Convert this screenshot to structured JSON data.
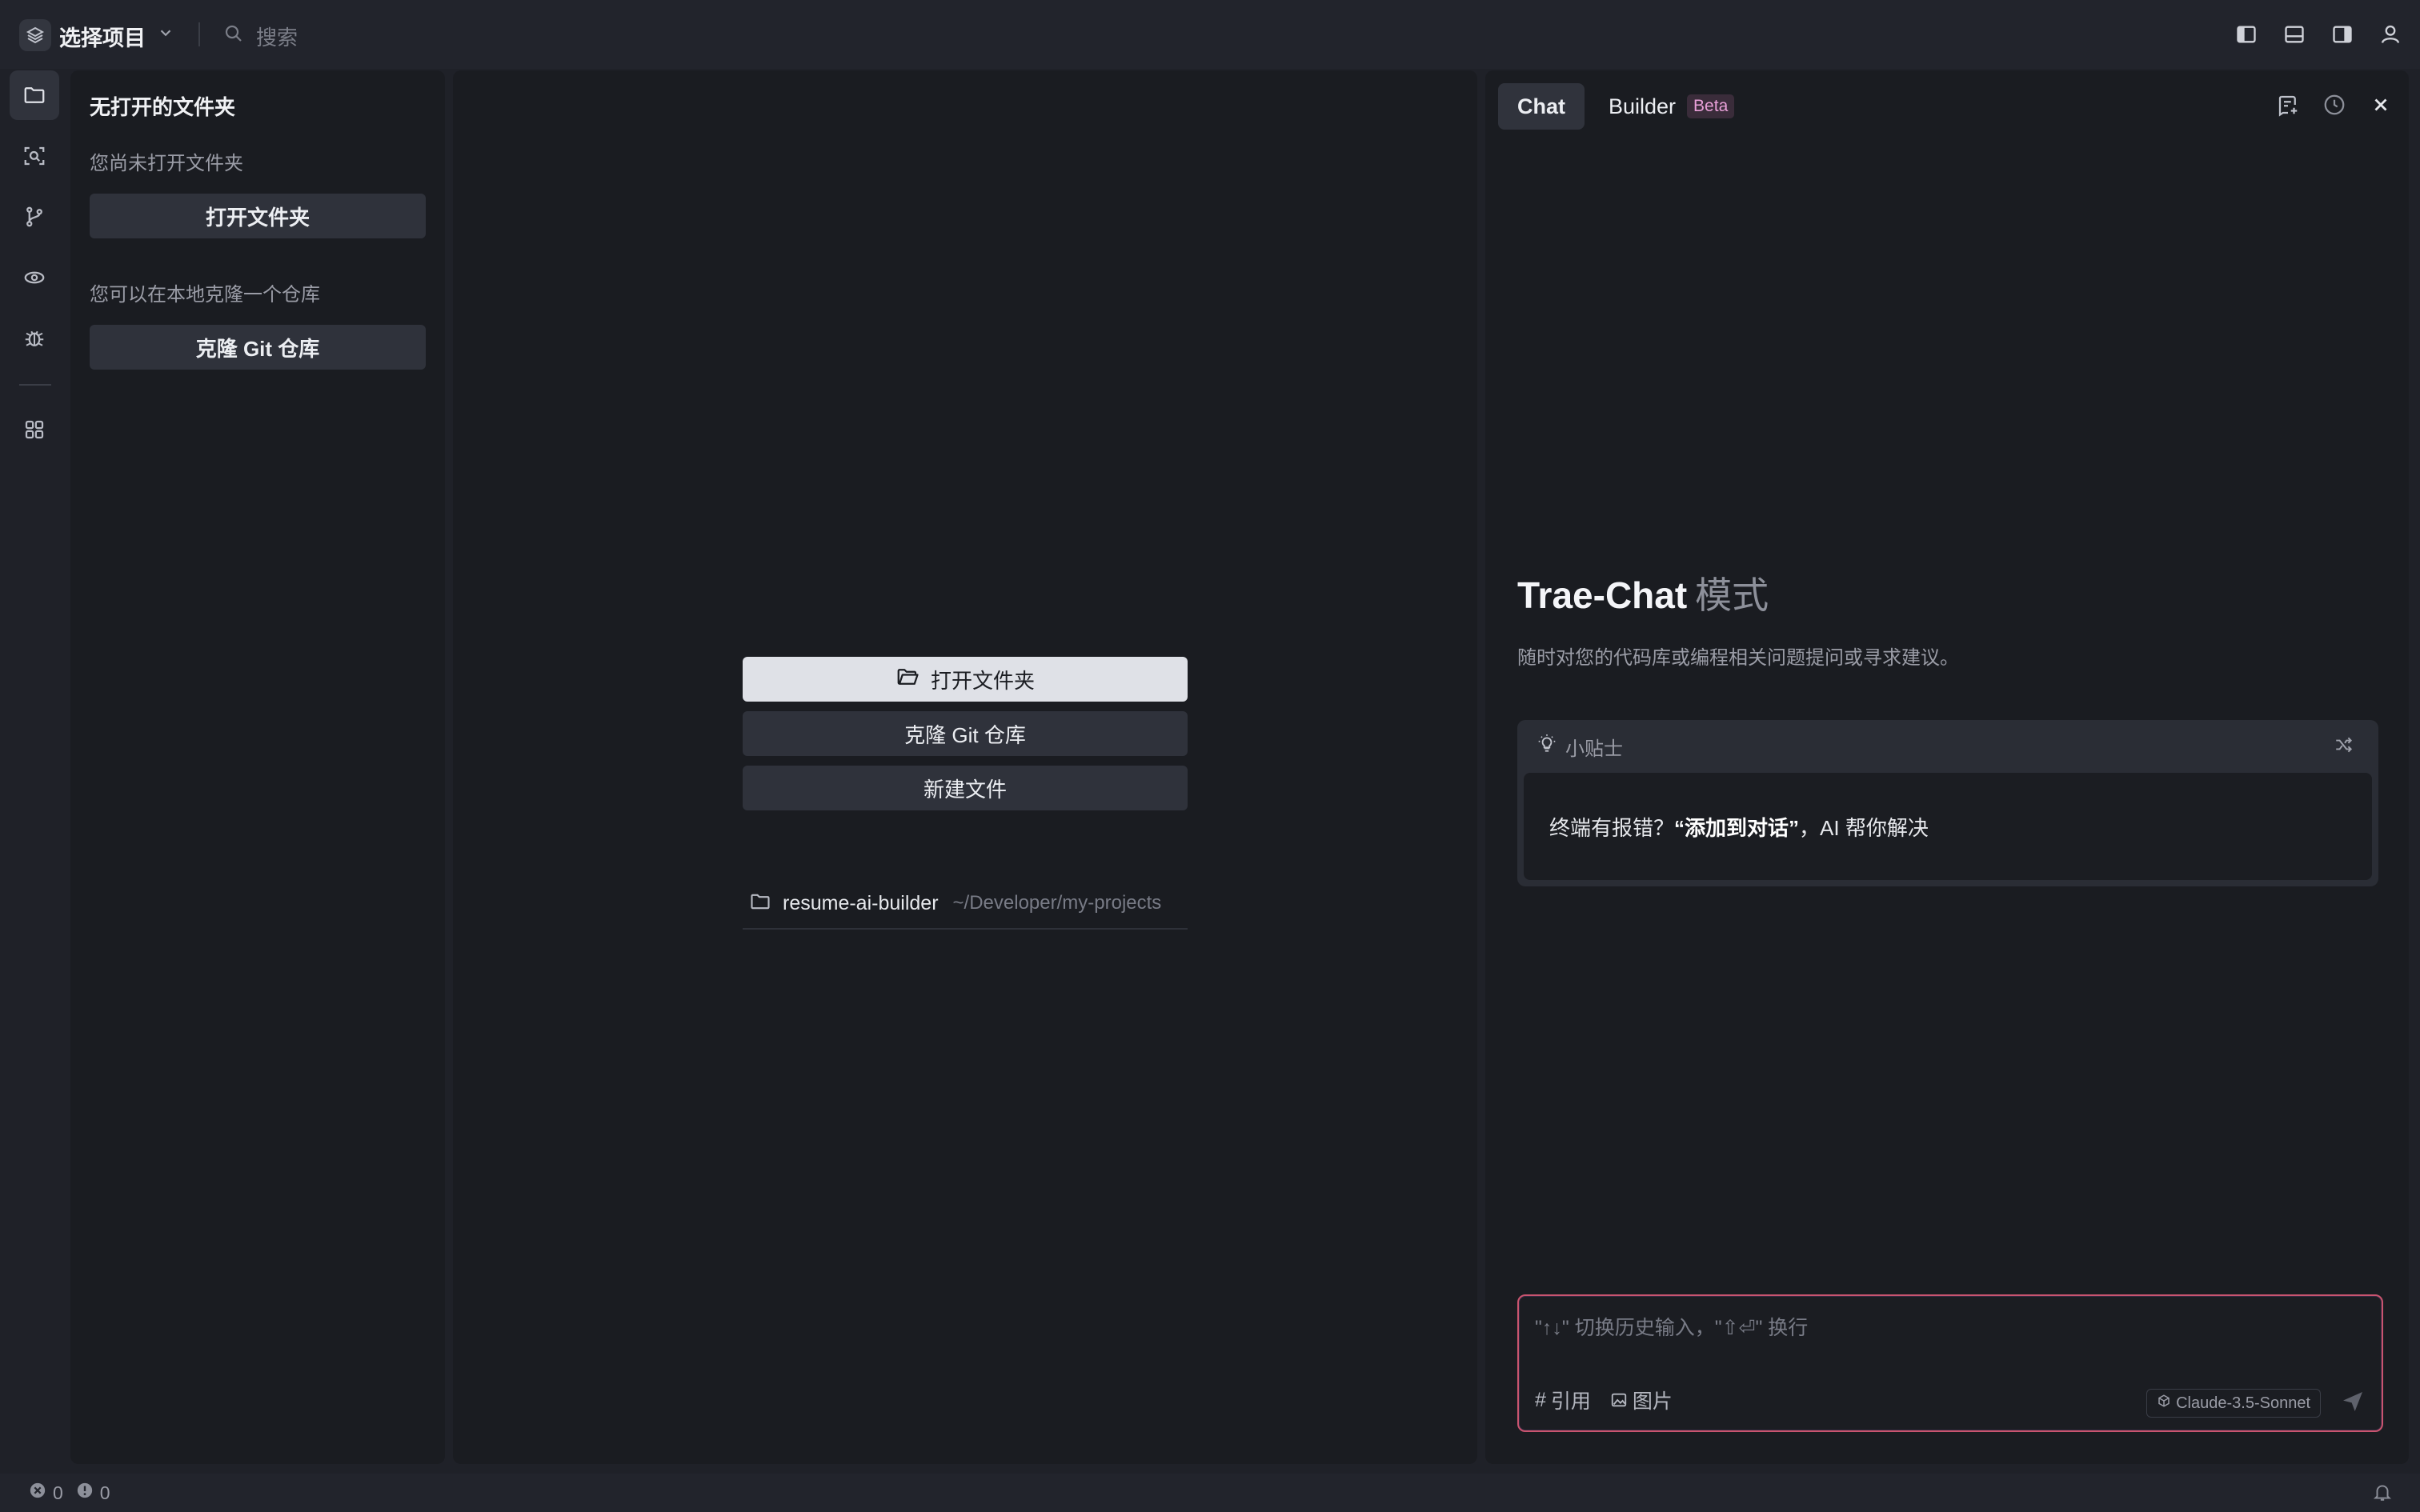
{
  "titlebar": {
    "project_label": "选择项目",
    "search_placeholder": "搜索"
  },
  "sidebar": {
    "title": "无打开的文件夹",
    "no_folder_msg": "您尚未打开文件夹",
    "open_folder_label": "打开文件夹",
    "clone_msg": "您可以在本地克隆一个仓库",
    "clone_label": "克隆 Git 仓库"
  },
  "editor": {
    "open_folder_label": "打开文件夹",
    "clone_label": "克隆 Git 仓库",
    "new_file_label": "新建文件",
    "recent": [
      {
        "name": "resume-ai-builder",
        "path": "~/Developer/my-projects"
      }
    ]
  },
  "chat": {
    "tabs": [
      {
        "label": "Chat"
      },
      {
        "label": "Builder",
        "badge": "Beta"
      }
    ],
    "mode_title": "Trae-Chat",
    "mode_suffix": "模式",
    "mode_desc": "随时对您的代码库或编程相关问题提问或寻求建议。",
    "tips_title": "小贴士",
    "tip_prefix": "终端有报错？",
    "tip_bold": "“添加到对话”",
    "tip_suffix": "，AI 帮你解决",
    "input_placeholder": "\"↑↓\" 切换历史输入，\"⇧⏎\" 换行",
    "ref_label": "引用",
    "image_label": "图片",
    "model": "Claude-3.5-Sonnet"
  },
  "status": {
    "errors": "0",
    "warnings": "0"
  },
  "colors": {
    "accent_border": "#c9546f",
    "beta": "#e8a0d8"
  }
}
